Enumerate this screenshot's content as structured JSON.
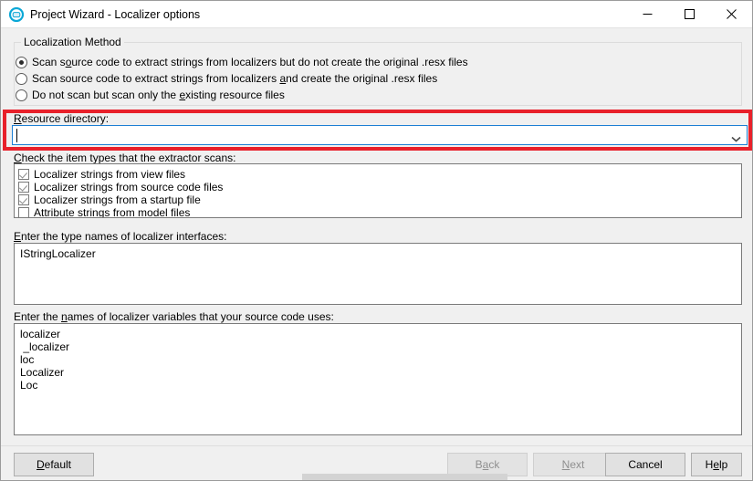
{
  "window": {
    "title": "Project Wizard - Localizer options",
    "icon": "app-circle-icon",
    "controls": {
      "minimize": "minimize-icon",
      "maximize": "maximize-icon",
      "close": "close-icon"
    }
  },
  "group": {
    "legend": "Localization Method",
    "options": [
      {
        "pre": "Scan s",
        "accel": "o",
        "post": "urce code to extract strings from localizers but do not create the original .resx files",
        "selected": true
      },
      {
        "pre": "Scan source code to extract strings from localizers ",
        "accel": "a",
        "post": "nd create the original .resx files",
        "selected": false
      },
      {
        "pre": "Do not scan but scan only the ",
        "accel": "e",
        "post": "xisting resource files",
        "selected": false
      }
    ]
  },
  "resource_directory": {
    "label_pre": "",
    "label_accel": "R",
    "label_post": "esource directory:",
    "value": "",
    "placeholder": "",
    "arrow_icon": "chevron-down-icon",
    "highlight_color": "#e8202a",
    "focus_border_color": "#1c7fd4"
  },
  "item_types": {
    "label_pre": "",
    "label_accel": "C",
    "label_post": "heck the item types that the extractor scans:",
    "items": [
      {
        "label": "Localizer strings from view files",
        "checked": true
      },
      {
        "label": "Localizer strings from source code files",
        "checked": true
      },
      {
        "label": "Localizer strings from a startup file",
        "checked": true
      },
      {
        "label": "Attribute strings from model files",
        "checked": false
      }
    ]
  },
  "interface_types": {
    "label_pre": "",
    "label_accel": "E",
    "label_post": "nter the type names of localizer interfaces:",
    "lines": [
      "IStringLocalizer"
    ]
  },
  "variable_names": {
    "label_pre": "Enter the ",
    "label_accel": "n",
    "label_post": "ames of localizer variables that your source code uses:",
    "lines": [
      "localizer",
      " _localizer",
      "loc",
      "Localizer",
      "Loc"
    ]
  },
  "footer": {
    "buttons": [
      {
        "pre": "D",
        "accel": "",
        "post": "efault",
        "label": "Default",
        "accel_char": "D",
        "before": "",
        "after": "efault",
        "disabled": false
      },
      {
        "label": "Back",
        "before": "B",
        "accel_char": "a",
        "after": "ck",
        "disabled": true
      },
      {
        "label": "Next",
        "before": "",
        "accel_char": "N",
        "after": "ext",
        "disabled": true
      },
      {
        "label": "Cancel",
        "before": "Cancel",
        "accel_char": "",
        "after": "",
        "disabled": false
      },
      {
        "label": "Help",
        "before": "H",
        "accel_char": "e",
        "after": "lp",
        "disabled": false
      }
    ]
  }
}
